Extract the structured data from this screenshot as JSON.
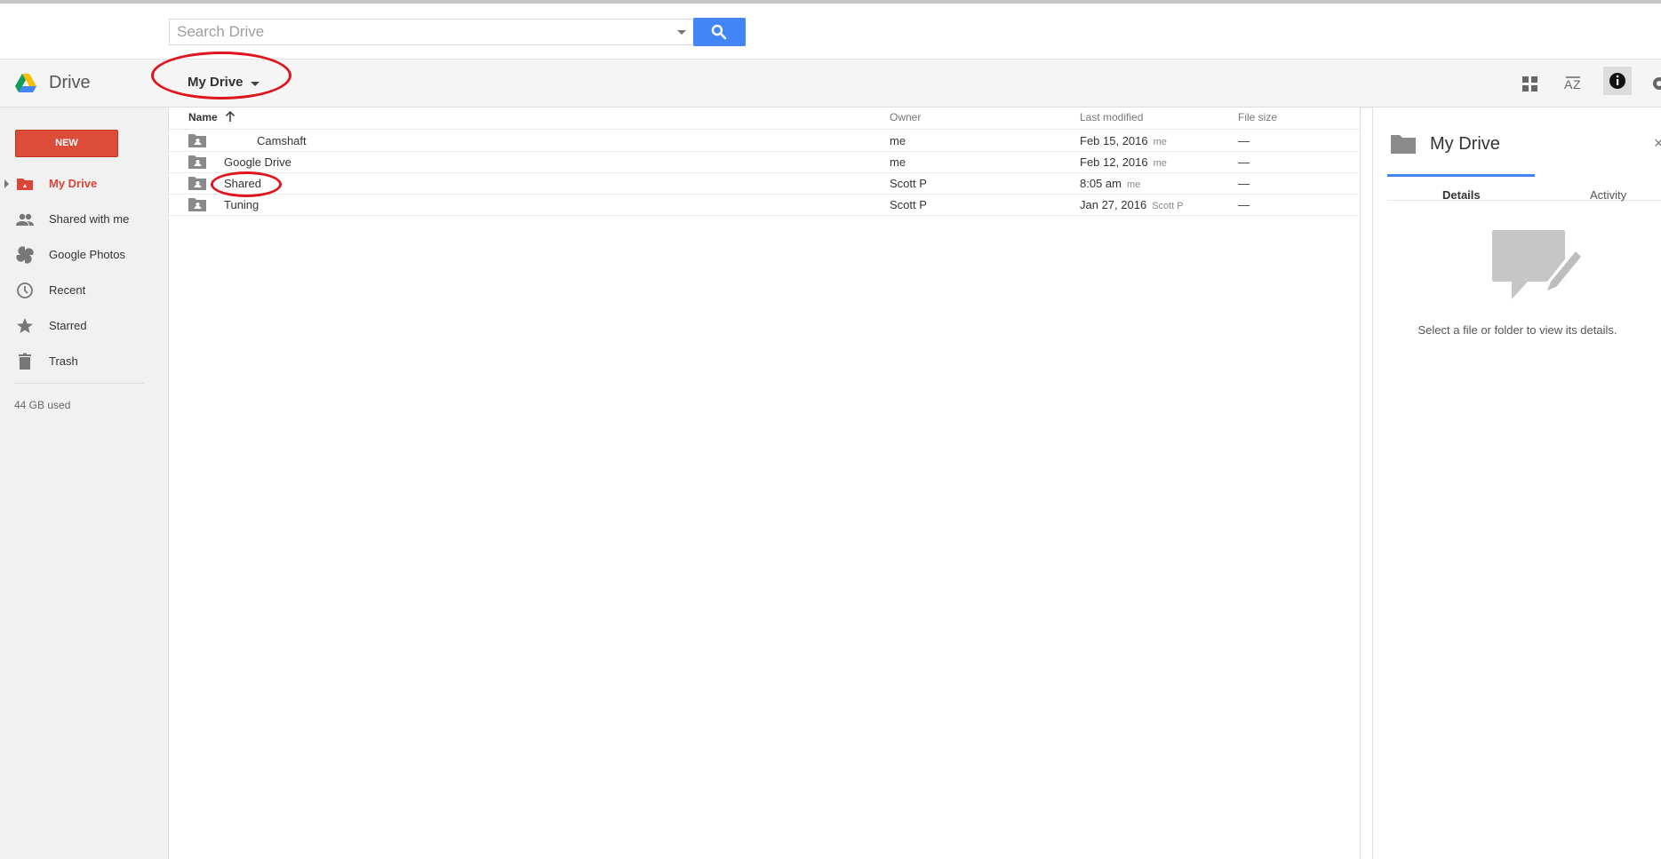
{
  "search": {
    "placeholder": "Search Drive"
  },
  "app": {
    "title": "Drive"
  },
  "header": {
    "breadcrumb": "My Drive"
  },
  "sidebar": {
    "new_label": "NEW",
    "items": [
      {
        "label": "My Drive",
        "active": true
      },
      {
        "label": "Shared with me"
      },
      {
        "label": "Google Photos"
      },
      {
        "label": "Recent"
      },
      {
        "label": "Starred"
      },
      {
        "label": "Trash"
      }
    ],
    "storage": "44 GB used"
  },
  "files": {
    "columns": {
      "name": "Name",
      "owner": "Owner",
      "modified": "Last modified",
      "size": "File size"
    },
    "rows": [
      {
        "name": "Camshaft",
        "owner": "me",
        "modified": "Feb 15, 2016",
        "modified_by": "me",
        "size": "—"
      },
      {
        "name": "Google Drive",
        "owner": "me",
        "modified": "Feb 12, 2016",
        "modified_by": "me",
        "size": "—"
      },
      {
        "name": "Shared",
        "owner": "Scott P",
        "modified": "8:05 am",
        "modified_by": "me",
        "size": "—"
      },
      {
        "name": "Tuning",
        "owner": "Scott P",
        "modified": "Jan 27, 2016",
        "modified_by": "Scott P",
        "size": "—"
      }
    ]
  },
  "details": {
    "title": "My Drive",
    "close": "×",
    "tabs": [
      "Details",
      "Activity"
    ],
    "hint": "Select a file or folder to view its details."
  },
  "colors": {
    "new_button": "#dd4b39",
    "accent_blue": "#4285f4",
    "active_nav": "#db4437",
    "annotation_ring": "#e0141e"
  }
}
